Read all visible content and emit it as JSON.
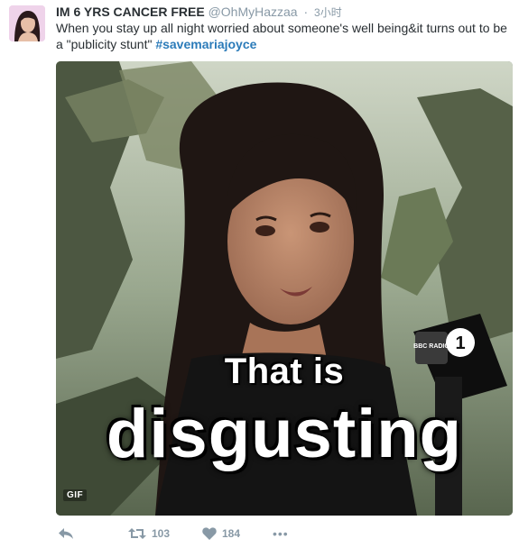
{
  "tweet": {
    "display_name": "IM 6 YRS CANCER FREE",
    "handle": "@OhMyHazzaa",
    "separator": "·",
    "time": "3小时",
    "text_before": "When you stay up all night worried about someone's well being&it turns out to be a \"publicity stunt\" ",
    "hashtag": "#savemariajoyce"
  },
  "media": {
    "caption_line1": "That is",
    "caption_line2": "disgusting",
    "badge": "GIF",
    "mic_badge_text": "BBC RADIO",
    "mic_number": "1"
  },
  "actions": {
    "retweet_count": "103",
    "like_count": "184",
    "more_label": "•••"
  },
  "colors": {
    "text": "#292f33",
    "muted": "#8899a6",
    "link": "#2b7bb9"
  },
  "icons": [
    "reply-icon",
    "retweet-icon",
    "heart-icon",
    "more-icon"
  ]
}
